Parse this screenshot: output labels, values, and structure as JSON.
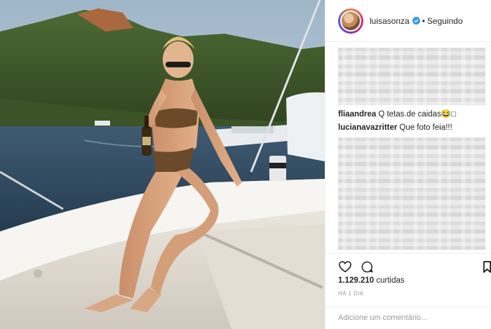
{
  "post": {
    "username": "luisasonza",
    "follow_status": "Seguindo",
    "separator": "•"
  },
  "comments": [
    {
      "user": "fliaandrea",
      "text": "Q tetas.de caidas😂□"
    },
    {
      "user": "lucianavazritter",
      "text": "Que foto feia!!!"
    }
  ],
  "engagement": {
    "likes_count": "1.129.210",
    "likes_label": "curtidas",
    "time_ago": "HÁ 1 DIA"
  },
  "compose": {
    "placeholder": "Adicione um comentário..."
  },
  "icons": {
    "like": "heart-icon",
    "comment": "comment-bubble-icon",
    "save": "bookmark-icon",
    "verified": "verified-badge-icon"
  },
  "colors": {
    "verified": "#3897f0",
    "text": "#262626",
    "muted": "#999999",
    "divider": "#efefef"
  }
}
